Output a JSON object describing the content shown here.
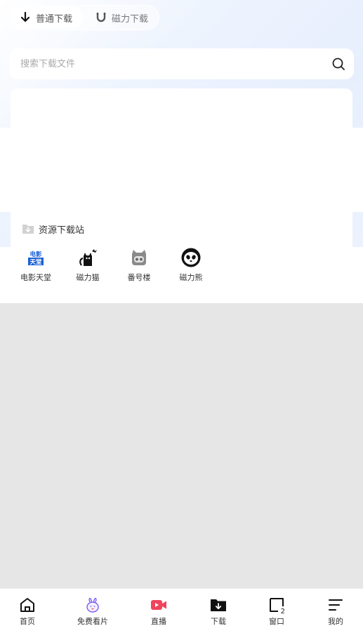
{
  "tabs": {
    "normal_label": "普通下载",
    "magnet_label": "磁力下载"
  },
  "search": {
    "placeholder": "搜索下载文件"
  },
  "section": {
    "title": "资源下载站"
  },
  "sites": [
    {
      "label": "电影天堂",
      "logo_line1": "电影",
      "logo_line2": "天堂",
      "icon": "movie-heaven-logo"
    },
    {
      "label": "磁力猫",
      "icon": "cat-logo"
    },
    {
      "label": "番号楼",
      "icon": "robot-cat-logo"
    },
    {
      "label": "磁力熊",
      "icon": "panda-logo"
    }
  ],
  "nav": {
    "items": [
      {
        "label": "首页",
        "icon": "home-icon"
      },
      {
        "label": "免费看片",
        "icon": "rabbit-icon"
      },
      {
        "label": "直播",
        "icon": "live-video-icon"
      },
      {
        "label": "下载",
        "icon": "download-folder-icon"
      },
      {
        "label": "窗口",
        "icon": "window-icon",
        "count": "2"
      },
      {
        "label": "我的",
        "icon": "menu-lines-icon"
      }
    ]
  },
  "colors": {
    "accent_live": "#f0445c",
    "accent_rabbit": "#7b5cf5",
    "logo_blue": "#1a5fd6"
  }
}
